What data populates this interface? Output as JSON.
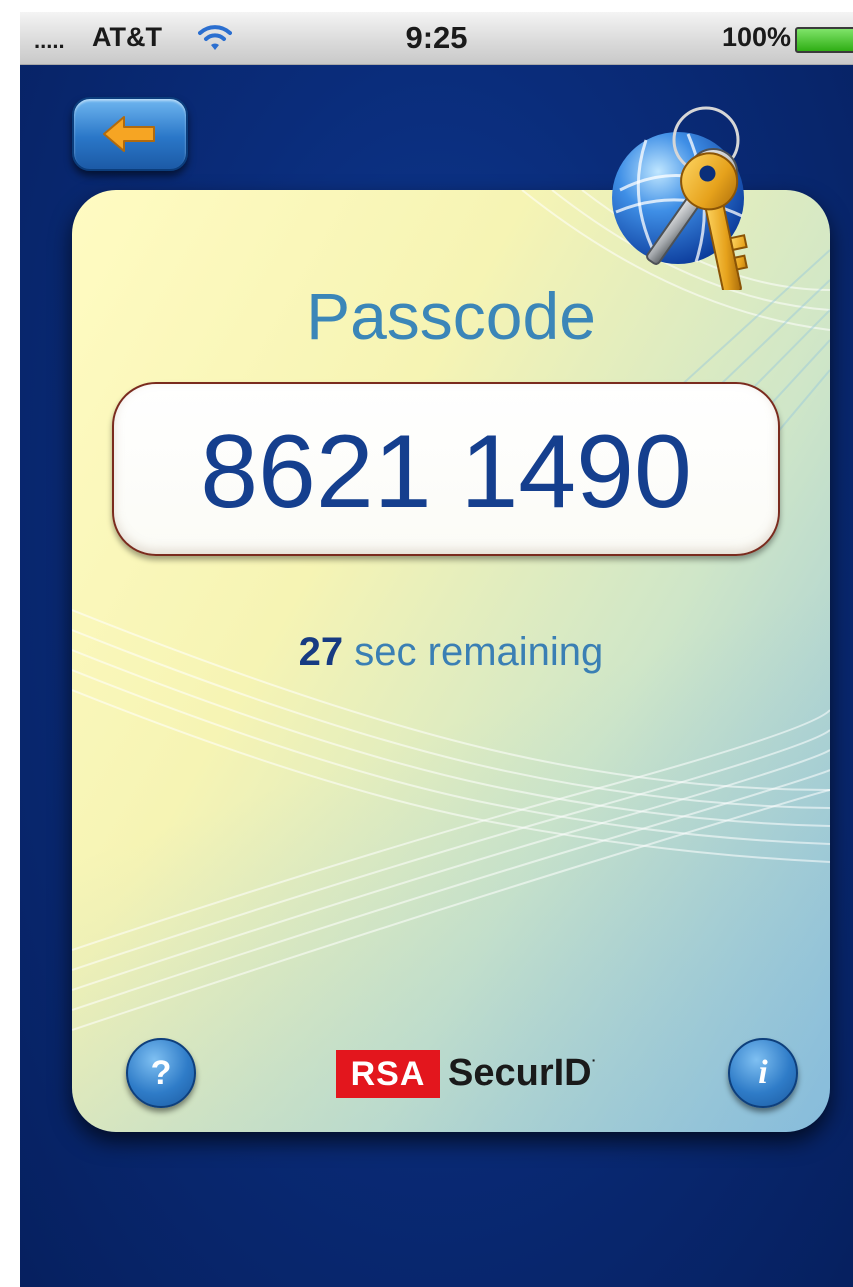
{
  "status_bar": {
    "signal": ".....",
    "carrier": "AT&T",
    "time": "9:25",
    "battery": "100%"
  },
  "nav": {
    "back_icon": "back-arrow-icon"
  },
  "token": {
    "title": "Passcode",
    "code": "8621 1490",
    "seconds": "27",
    "remaining_label": "sec remaining"
  },
  "footer": {
    "help_label": "?",
    "info_label": "i",
    "brand_mark": "RSA",
    "brand_name": "SecurID"
  },
  "colors": {
    "background": "#0a2c7a",
    "title": "#3b86b8",
    "code": "#153f8e",
    "brand_red": "#e3161d"
  }
}
